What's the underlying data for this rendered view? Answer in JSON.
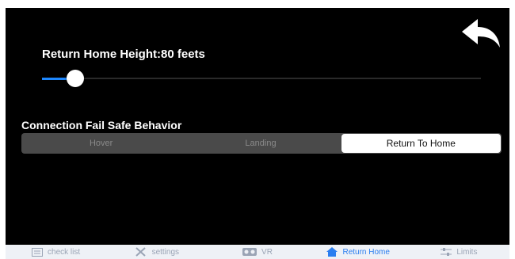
{
  "return_home": {
    "height_label": "Return Home Height:80 feets",
    "height_fraction": 0.075
  },
  "fail_safe": {
    "title": "Connection Fail Safe Behavior",
    "options": [
      "Hover",
      "Landing",
      "Return To Home"
    ],
    "selected_index": 2
  },
  "tabs": [
    {
      "label": "check list",
      "icon": "checklist-icon",
      "active": false
    },
    {
      "label": "settings",
      "icon": "tools-icon",
      "active": false
    },
    {
      "label": "VR",
      "icon": "vr-headset-icon",
      "active": false
    },
    {
      "label": "Return Home",
      "icon": "home-icon",
      "active": true
    },
    {
      "label": "Limits",
      "icon": "sliders-icon",
      "active": false
    }
  ],
  "colors": {
    "background": "#000000",
    "accent": "#1e88ff",
    "tab_active": "#2a7ef0",
    "tab_inactive": "#9aa4b5"
  }
}
